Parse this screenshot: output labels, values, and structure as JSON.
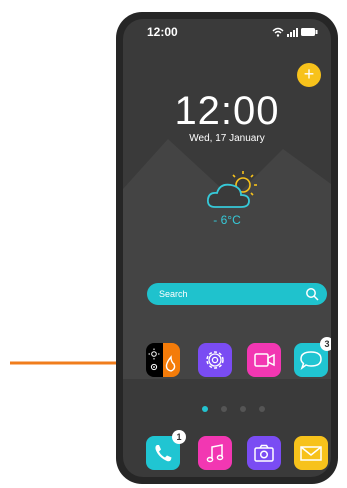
{
  "status_bar": {
    "time": "12:00",
    "icons": [
      "wifi-icon",
      "signal-icon",
      "battery-icon"
    ]
  },
  "lock": {
    "time": "12:00",
    "date": "Wed, 17 January"
  },
  "weather": {
    "icon": "partly-sunny-icon",
    "temperature": "- 6°C"
  },
  "search": {
    "placeholder": "Search"
  },
  "apps_row": [
    {
      "name": "theme-toggle",
      "colors": [
        "#000000",
        "#f47c0a"
      ]
    },
    {
      "name": "settings",
      "color": "#7a4cf3"
    },
    {
      "name": "video",
      "color": "#f237b2"
    },
    {
      "name": "messages",
      "color": "#20c5d2",
      "badge": "3"
    }
  ],
  "dock": [
    {
      "name": "phone",
      "color": "#20c5d2",
      "badge": "1"
    },
    {
      "name": "music",
      "color": "#f237b2"
    },
    {
      "name": "camera",
      "color": "#7a4cf3"
    },
    {
      "name": "mail",
      "color": "#f7c21b"
    }
  ],
  "page_indicator": {
    "count": 4,
    "active": 1
  },
  "colors": {
    "arrow": "#f07d1c",
    "accent": "#1fc2cd",
    "background": "#3a3a3a"
  }
}
